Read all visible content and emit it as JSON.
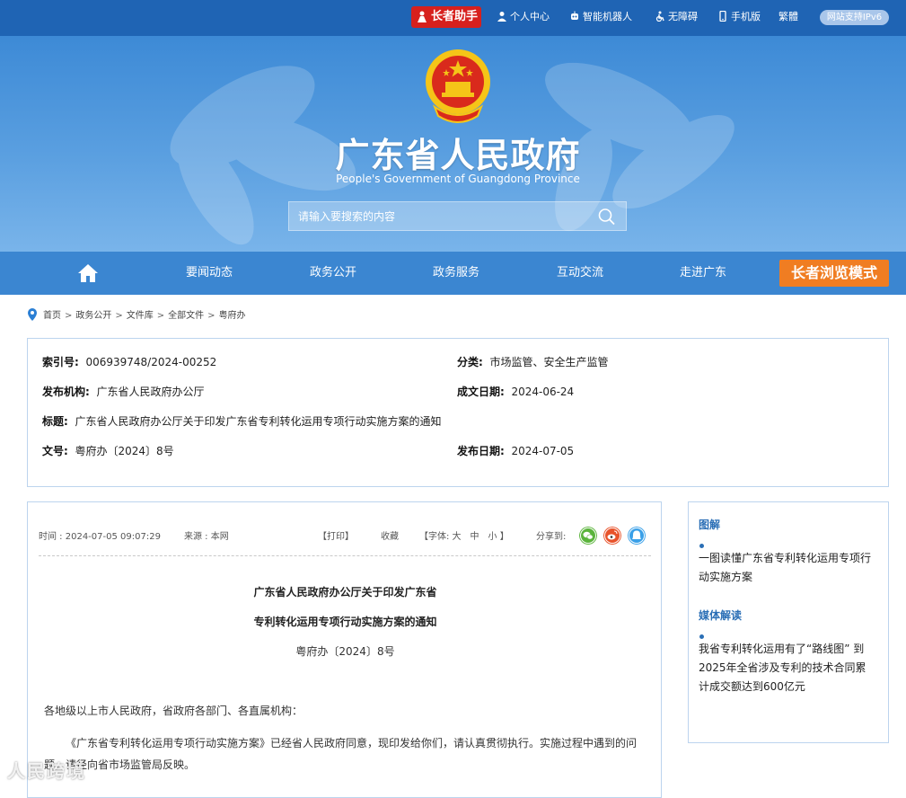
{
  "topbar": {
    "elder_assistant": "长者助手",
    "personal_center": "个人中心",
    "robot": "智能机器人",
    "accessibility": "无障碍",
    "mobile": "手机版",
    "traditional": "繁體",
    "ipv6": "网站支持IPv6"
  },
  "header": {
    "title": "广东省人民政府",
    "subtitle": "People's Government of Guangdong Province",
    "search_placeholder": "请输入要搜索的内容"
  },
  "nav": {
    "items": [
      "要闻动态",
      "政务公开",
      "政务服务",
      "互动交流",
      "走进广东"
    ],
    "elder_mode": "长者浏览模式"
  },
  "breadcrumb": [
    "首页",
    "政务公开",
    "文件库",
    "全部文件",
    "粤府办"
  ],
  "info": {
    "index_label": "索引号:",
    "index_value": "006939748/2024-00252",
    "category_label": "分类:",
    "category_value": "市场监管、安全生产监管",
    "issuer_label": "发布机构:",
    "issuer_value": "广东省人民政府办公厅",
    "created_label": "成文日期:",
    "created_value": "2024-06-24",
    "title_label": "标题:",
    "title_value": "广东省人民政府办公厅关于印发广东省专利转化运用专项行动实施方案的通知",
    "docno_label": "文号:",
    "docno_value": "粤府办〔2024〕8号",
    "pubdate_label": "发布日期:",
    "pubdate_value": "2024-07-05"
  },
  "article": {
    "time": "时间 : 2024-07-05 09:07:29",
    "source": "来源 : 本网",
    "print": "【打印】",
    "favorite": "收藏",
    "font_size": "【字体: 大　中　小 】",
    "share_label": "分享到:",
    "title_line1": "广东省人民政府办公厅关于印发广东省",
    "title_line2": "专利转化运用专项行动实施方案的通知",
    "doc_number": "粤府办〔2024〕8号",
    "salutation": "各地级以上市人民政府，省政府各部门、各直属机构：",
    "body": "《广东省专利转化运用专项行动实施方案》已经省人民政府同意，现印发给你们，请认真贯彻执行。实施过程中遇到的问题，请径向省市场监管局反映。"
  },
  "sidebar": {
    "section1_title": "图解",
    "section1_link": "一图读懂广东省专利转化运用专项行动实施方案",
    "section2_title": "媒体解读",
    "section2_link": "我省专利转化运用有了“路线图” 到2025年全省涉及专利的技术合同累计成交额达到600亿元"
  },
  "watermark": "人民跨境",
  "colors": {
    "topbar": "#1f64b4",
    "nav": "#3b86d1",
    "elder_red": "#d7201d",
    "elder_orange": "#f07d22",
    "accent_blue": "#2b6fb6",
    "wechat": "#5bb43c",
    "weibo": "#e8532b",
    "qq": "#3aa0e8"
  },
  "icons": [
    "elder-icon",
    "person-icon",
    "robot-icon",
    "accessibility-icon",
    "phone-icon",
    "search-icon",
    "home-icon",
    "location-pin-icon",
    "wechat-icon",
    "weibo-icon",
    "qq-icon"
  ]
}
